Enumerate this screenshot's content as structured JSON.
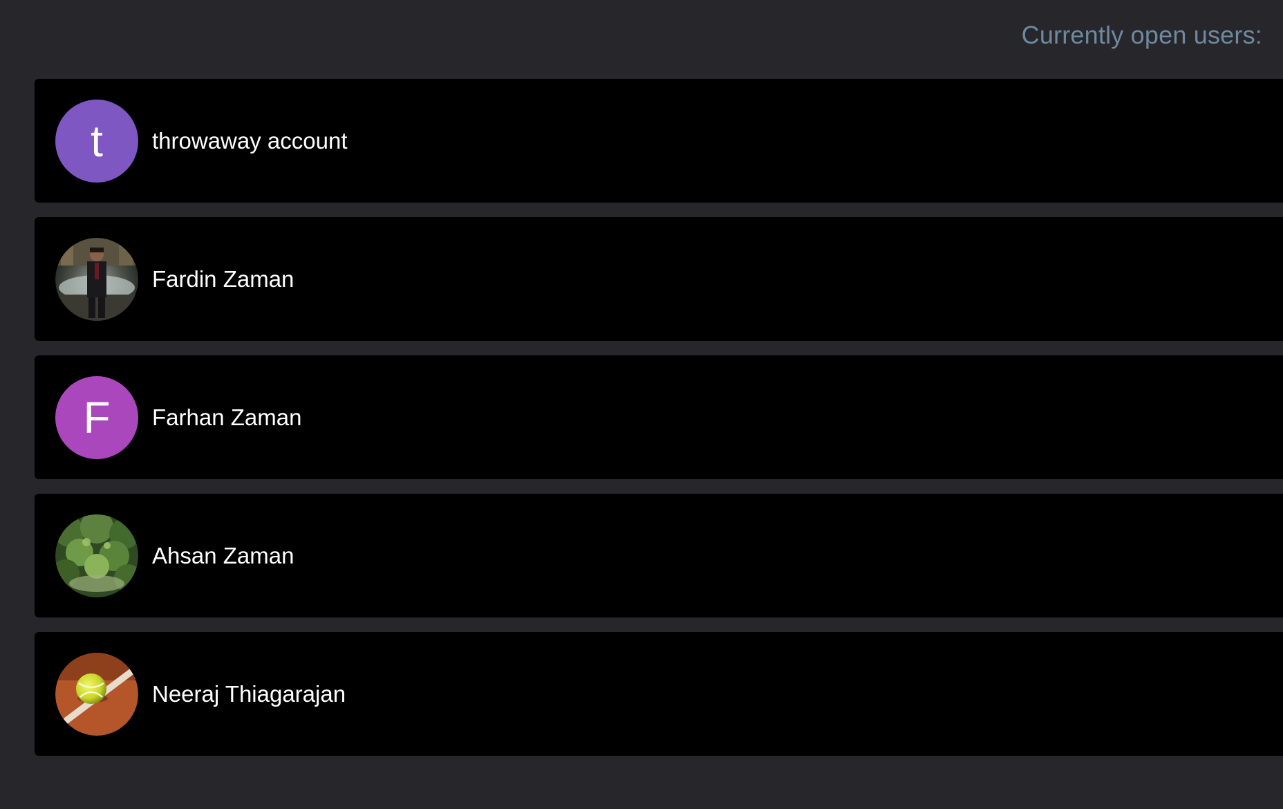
{
  "header": {
    "label": "Currently open users:"
  },
  "users": [
    {
      "name": "throwaway account",
      "avatar_type": "initial",
      "initial": "t",
      "avatar_color": "#7e57c2"
    },
    {
      "name": "Fardin Zaman",
      "avatar_type": "photo",
      "photo_icon": "person-in-suit-photo"
    },
    {
      "name": "Farhan Zaman",
      "avatar_type": "initial",
      "initial": "F",
      "avatar_color": "#ab47bc"
    },
    {
      "name": "Ahsan Zaman",
      "avatar_type": "photo",
      "photo_icon": "forest-photo"
    },
    {
      "name": "Neeraj Thiagarajan",
      "avatar_type": "photo",
      "photo_icon": "tennis-ball-photo"
    }
  ],
  "colors": {
    "background": "#27272b",
    "row_background": "#000000",
    "header_text": "#6d8aa0",
    "name_text": "#ffffff"
  }
}
